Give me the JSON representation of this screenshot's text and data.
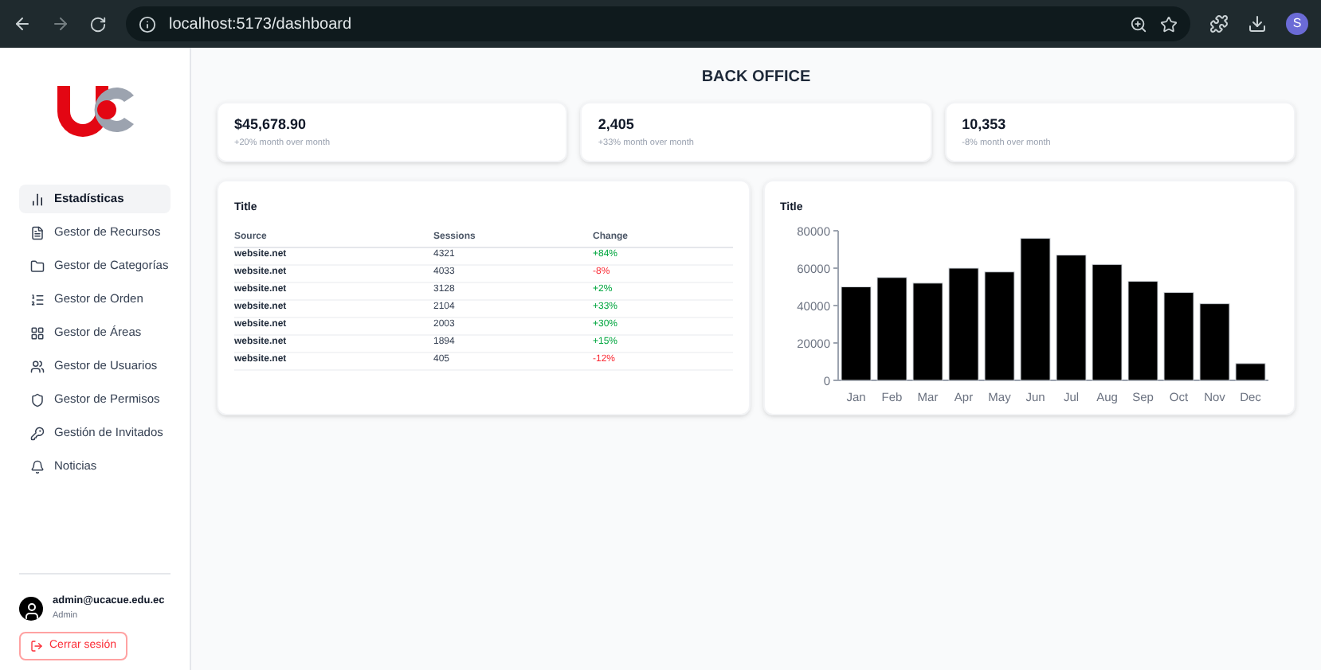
{
  "browser": {
    "url": "localhost:5173/dashboard",
    "profile": "S"
  },
  "sidebar": {
    "items": [
      {
        "label": "Estadísticas",
        "selected": true
      },
      {
        "label": "Gestor de Recursos",
        "selected": false
      },
      {
        "label": "Gestor de Categorías",
        "selected": false
      },
      {
        "label": "Gestor de Orden",
        "selected": false
      },
      {
        "label": "Gestor de Áreas",
        "selected": false
      },
      {
        "label": "Gestor de Usuarios",
        "selected": false
      },
      {
        "label": "Gestor de Permisos",
        "selected": false
      },
      {
        "label": "Gestión de Invitados",
        "selected": false
      },
      {
        "label": "Noticias",
        "selected": false
      }
    ],
    "user": {
      "email": "admin@ucacue.edu.ec",
      "role": "Admin"
    },
    "logout": "Cerrar sesión"
  },
  "page_title": "BACK OFFICE",
  "stats": [
    {
      "value": "$45,678.90",
      "caption": "+20% month over month"
    },
    {
      "value": "2,405",
      "caption": "+33% month over month"
    },
    {
      "value": "10,353",
      "caption": "-8% month over month"
    }
  ],
  "table": {
    "title": "Title",
    "columns": [
      "Source",
      "Sessions",
      "Change"
    ],
    "rows": [
      {
        "source": "website.net",
        "sessions": "4321",
        "change": "+84%",
        "kind": "gain"
      },
      {
        "source": "website.net",
        "sessions": "4033",
        "change": "-8%",
        "kind": "loss"
      },
      {
        "source": "website.net",
        "sessions": "3128",
        "change": "+2%",
        "kind": "gain"
      },
      {
        "source": "website.net",
        "sessions": "2104",
        "change": "+33%",
        "kind": "gain"
      },
      {
        "source": "website.net",
        "sessions": "2003",
        "change": "+30%",
        "kind": "gain"
      },
      {
        "source": "website.net",
        "sessions": "1894",
        "change": "+15%",
        "kind": "gain"
      },
      {
        "source": "website.net",
        "sessions": "405",
        "change": "-12%",
        "kind": "loss"
      }
    ]
  },
  "chart": {
    "title": "Title",
    "chart_data": {
      "type": "bar",
      "categories": [
        "Jan",
        "Feb",
        "Mar",
        "Apr",
        "May",
        "Jun",
        "Jul",
        "Aug",
        "Sep",
        "Oct",
        "Nov",
        "Dec"
      ],
      "series": [
        {
          "color": "#000000",
          "values": [
            50000,
            55000,
            52000,
            60000,
            58000,
            76000,
            67000,
            62000,
            53000,
            47000,
            41000,
            9000
          ]
        }
      ],
      "ylim": [
        0,
        80000
      ],
      "yticks": [
        0,
        20000,
        40000,
        60000,
        80000
      ]
    }
  }
}
